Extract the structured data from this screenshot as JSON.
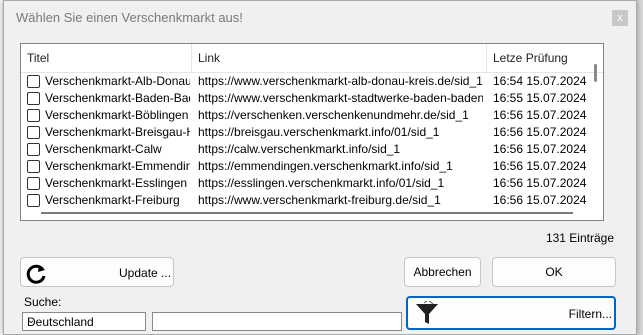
{
  "dialog": {
    "title": "Wählen Sie einen Verschenkmarkt aus!",
    "close_glyph": "x"
  },
  "table": {
    "columns": [
      "Titel",
      "Link",
      "Letze Prüfung"
    ],
    "rows": [
      {
        "titel": "Verschenkmarkt-Alb-Donau-...",
        "link": "https://www.verschenkmarkt-alb-donau-kreis.de/sid_1",
        "datum": "16:54 15.07.2024"
      },
      {
        "titel": "Verschenkmarkt-Baden-Baden",
        "link": "https://www.verschenkmarkt-stadtwerke-baden-baden.d...",
        "datum": "16:55 15.07.2024"
      },
      {
        "titel": "Verschenkmarkt-Böblingen",
        "link": "https://verschenken.verschenkenundmehr.de/sid_1",
        "datum": "16:56 15.07.2024"
      },
      {
        "titel": "Verschenkmarkt-Breisgau-H...",
        "link": "https://breisgau.verschenkmarkt.info/01/sid_1",
        "datum": "16:56 15.07.2024"
      },
      {
        "titel": "Verschenkmarkt-Calw",
        "link": "https://calw.verschenkmarkt.info/sid_1",
        "datum": "16:56 15.07.2024"
      },
      {
        "titel": "Verschenkmarkt-Emmending...",
        "link": "https://emmendingen.verschenkmarkt.info/sid_1",
        "datum": "16:56 15.07.2024"
      },
      {
        "titel": "Verschenkmarkt-Esslingen",
        "link": "https://esslingen.verschenkmarkt.info/01/sid_1",
        "datum": "16:56 15.07.2024"
      },
      {
        "titel": "Verschenkmarkt-Freiburg",
        "link": "https://www.verschenkmarkt-freiburg.de/sid_1",
        "datum": "16:56 15.07.2024"
      }
    ]
  },
  "count_label": "131 Einträge",
  "buttons": {
    "update": "Update ...",
    "abbrechen": "Abbrechen",
    "ok": "OK",
    "filter": "Filtern..."
  },
  "search": {
    "label": "Suche:",
    "region_value": "Deutschland",
    "text_value": ""
  },
  "icons": {
    "update": "refresh-icon",
    "filter": "funnel-filter-icon",
    "dropdown": "chevron-down-icon"
  },
  "colors": {
    "accent_border": "#0067c0",
    "dialog_bg": "#f0f0f0"
  }
}
